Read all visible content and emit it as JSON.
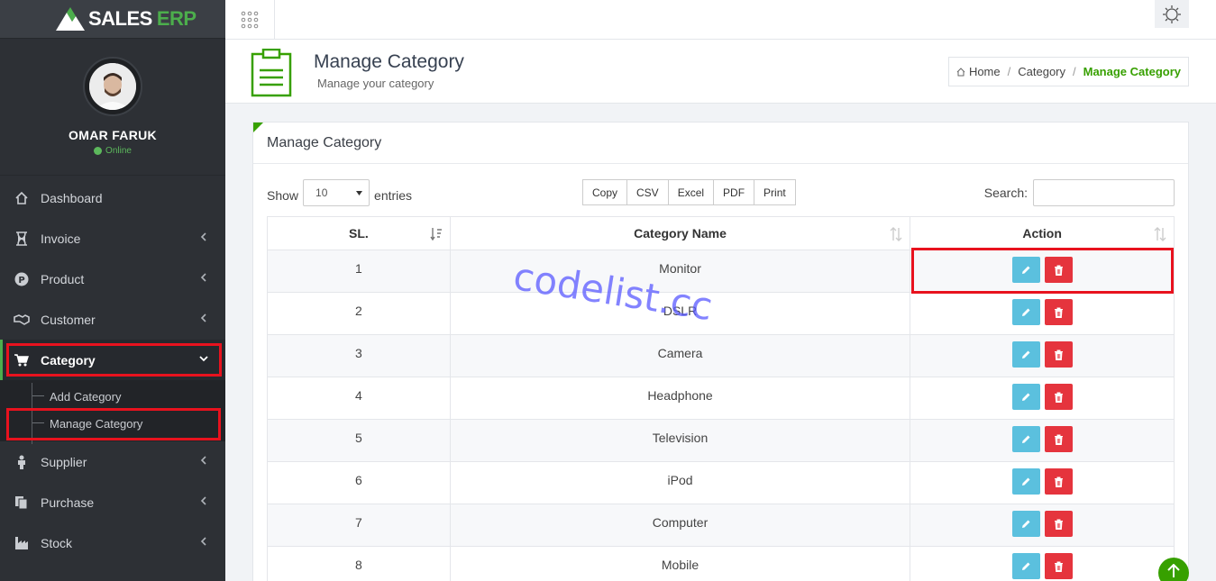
{
  "brand": {
    "name_a": "SALES",
    "name_b": "ERP"
  },
  "profile": {
    "name": "OMAR FARUK",
    "status": "Online"
  },
  "sidebar": {
    "items": [
      {
        "label": "Dashboard"
      },
      {
        "label": "Invoice"
      },
      {
        "label": "Product"
      },
      {
        "label": "Customer"
      },
      {
        "label": "Category"
      },
      {
        "label": "Supplier"
      },
      {
        "label": "Purchase"
      },
      {
        "label": "Stock"
      }
    ],
    "category_sub": [
      {
        "label": "Add Category"
      },
      {
        "label": "Manage Category"
      }
    ]
  },
  "page": {
    "title": "Manage Category",
    "subtitle": "Manage your category"
  },
  "breadcrumb": {
    "home": "Home",
    "parent": "Category",
    "current": "Manage Category"
  },
  "panel": {
    "title": "Manage Category"
  },
  "controls": {
    "show_label": "Show",
    "entries_value": "10",
    "entries_label": "entries",
    "buttons": [
      "Copy",
      "CSV",
      "Excel",
      "PDF",
      "Print"
    ],
    "search_label": "Search:"
  },
  "table": {
    "headers": [
      "SL.",
      "Category Name",
      "Action"
    ],
    "rows": [
      {
        "sl": "1",
        "name": "Monitor"
      },
      {
        "sl": "2",
        "name": "DSLR"
      },
      {
        "sl": "3",
        "name": "Camera"
      },
      {
        "sl": "4",
        "name": "Headphone"
      },
      {
        "sl": "5",
        "name": "Television"
      },
      {
        "sl": "6",
        "name": "iPod"
      },
      {
        "sl": "7",
        "name": "Computer"
      },
      {
        "sl": "8",
        "name": "Mobile"
      }
    ]
  },
  "watermark": "codelist.cc",
  "colors": {
    "accent": "#37a000",
    "edit": "#5bc0de",
    "delete": "#e5343d",
    "highlight": "#e8121e"
  }
}
